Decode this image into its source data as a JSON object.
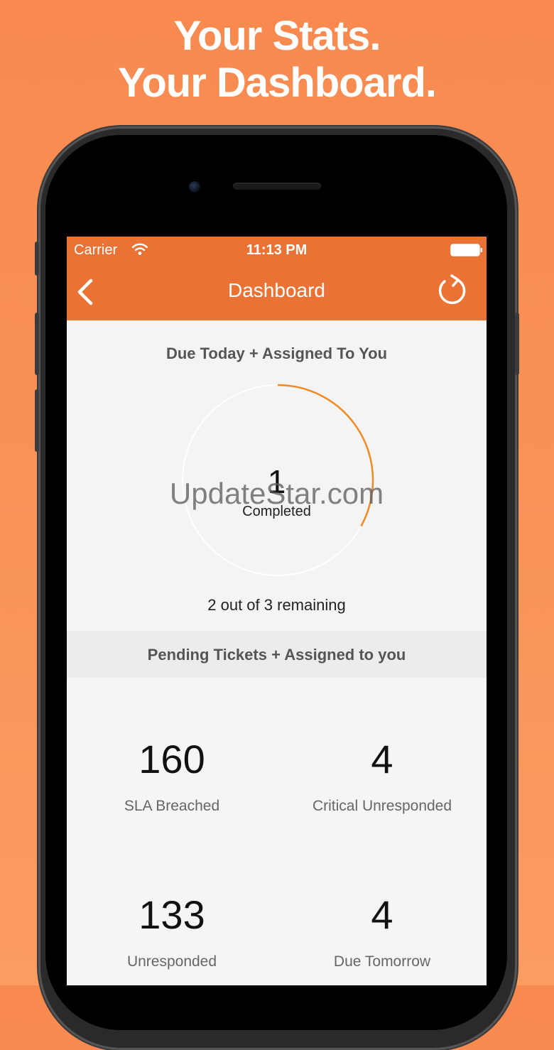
{
  "headline": {
    "line1": "Your Stats.",
    "line2": "Your Dashboard."
  },
  "status_bar": {
    "carrier": "Carrier",
    "time": "11:13 PM"
  },
  "navbar": {
    "title": "Dashboard"
  },
  "due_today": {
    "title": "Due Today + Assigned To You",
    "completed_value": "1",
    "completed_label": "Completed",
    "remaining_text": "2 out of 3 remaining",
    "progress_fraction": 0.33
  },
  "watermark": "UpdateStar.com",
  "pending": {
    "title": "Pending Tickets + Assigned to you",
    "stats": [
      {
        "value": "160",
        "label": "SLA Breached"
      },
      {
        "value": "4",
        "label": "Critical Unresponded"
      },
      {
        "value": "133",
        "label": "Unresponded"
      },
      {
        "value": "4",
        "label": "Due Tomorrow"
      }
    ]
  },
  "colors": {
    "accent": "#ea7235",
    "progress_arc": "#f08a24",
    "background": "#f88a50"
  }
}
